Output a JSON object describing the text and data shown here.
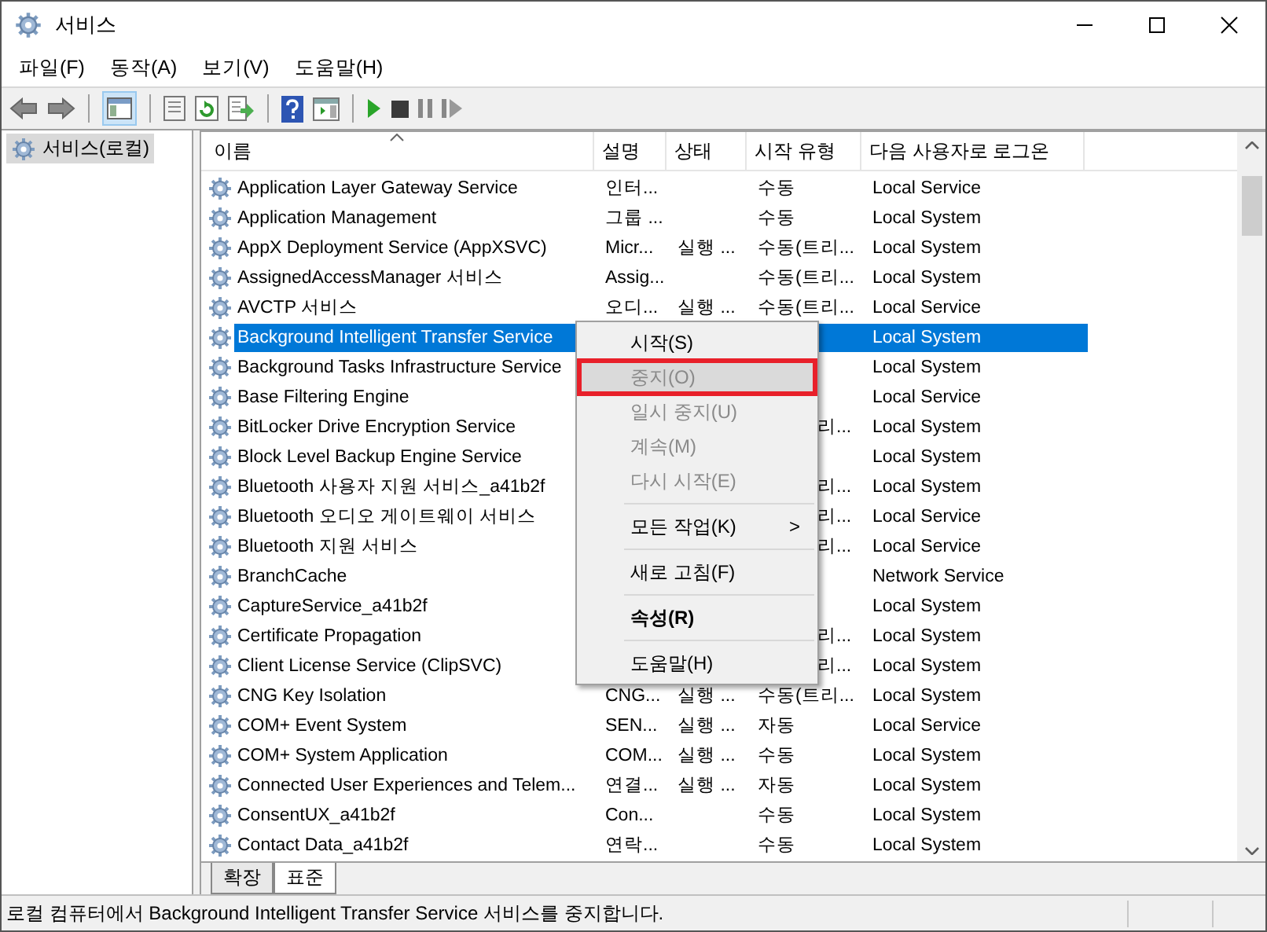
{
  "window": {
    "title": "서비스"
  },
  "menu": [
    "파일(F)",
    "동작(A)",
    "보기(V)",
    "도움말(H)"
  ],
  "toolbar": {
    "console_tree_selected": true
  },
  "tree": [
    {
      "label": "서비스(로컬)",
      "selected": true
    }
  ],
  "table": {
    "columns": [
      {
        "label": "이름",
        "sorted": true
      },
      {
        "label": "설명"
      },
      {
        "label": "상태"
      },
      {
        "label": "시작 유형"
      },
      {
        "label": "다음 사용자로 로그온"
      }
    ],
    "rows": [
      {
        "name": "Application Layer Gateway Service",
        "description": "인터...",
        "start_type": "수동",
        "logon": "Local Service",
        "selected": false
      },
      {
        "name": "Application Management",
        "description": "그룹 ...",
        "start_type": "수동",
        "logon": "Local System",
        "selected": false
      },
      {
        "name": "AppX Deployment Service (AppXSVC)",
        "description": "Micr...",
        "status": "실행 ...",
        "start_type": "수동(트리...",
        "logon": "Local System",
        "selected": false
      },
      {
        "name": "AssignedAccessManager 서비스",
        "description": "Assig...",
        "start_type": "수동(트리...",
        "logon": "Local System",
        "selected": false
      },
      {
        "name": "AVCTP 서비스",
        "description": "오디...",
        "status": "실행 ...",
        "start_type": "수동(트리...",
        "logon": "Local Service",
        "selected": false
      },
      {
        "name": "Background Intelligent Transfer Service",
        "logon": "Local System",
        "selected": true
      },
      {
        "name": "Background Tasks Infrastructure Service",
        "logon": "Local System",
        "selected": false
      },
      {
        "name": "Base Filtering Engine",
        "logon": "Local Service",
        "selected": false
      },
      {
        "name": "BitLocker Drive Encryption Service",
        "start_type": "리...",
        "covered": true,
        "logon": "Local System",
        "selected": false
      },
      {
        "name": "Block Level Backup Engine Service",
        "logon": "Local System",
        "selected": false
      },
      {
        "name": "Bluetooth 사용자 지원 서비스_a41b2f",
        "start_type": "리...",
        "covered": true,
        "logon": "Local System",
        "selected": false
      },
      {
        "name": "Bluetooth 오디오 게이트웨이 서비스",
        "start_type": "리...",
        "covered": true,
        "logon": "Local Service",
        "selected": false
      },
      {
        "name": "Bluetooth 지원 서비스",
        "start_type": "리...",
        "covered": true,
        "logon": "Local Service",
        "selected": false
      },
      {
        "name": "BranchCache",
        "logon": "Network Service",
        "selected": false
      },
      {
        "name": "CaptureService_a41b2f",
        "logon": "Local System",
        "selected": false
      },
      {
        "name": "Certificate Propagation",
        "start_type": "리...",
        "covered": true,
        "logon": "Local System",
        "selected": false
      },
      {
        "name": "Client License Service (ClipSVC)",
        "start_type": "리...",
        "covered": true,
        "logon": "Local System",
        "selected": false
      },
      {
        "name": "CNG Key Isolation",
        "description": "CNG...",
        "status": "실행 ...",
        "start_type": "수동(트리...",
        "logon": "Local System",
        "selected": false
      },
      {
        "name": "COM+ Event System",
        "description": "SEN...",
        "status": "실행 ...",
        "start_type": "자동",
        "logon": "Local Service",
        "selected": false
      },
      {
        "name": "COM+ System Application",
        "description": "COM...",
        "status": "실행 ...",
        "start_type": "수동",
        "logon": "Local System",
        "selected": false
      },
      {
        "name": "Connected User Experiences and Telem...",
        "description": "연결...",
        "status": "실행 ...",
        "start_type": "자동",
        "logon": "Local System",
        "selected": false
      },
      {
        "name": "ConsentUX_a41b2f",
        "description": "Con...",
        "start_type": "수동",
        "logon": "Local System",
        "selected": false
      },
      {
        "name": "Contact Data_a41b2f",
        "description": "연락...",
        "start_type": "수동",
        "logon": "Local System",
        "selected": false
      }
    ]
  },
  "tabs": [
    {
      "label": "확장",
      "selected": false
    },
    {
      "label": "표준",
      "selected": true
    }
  ],
  "context_menu": [
    {
      "kind": "item",
      "label": "시작(S)",
      "disabled": false,
      "highlighted": false
    },
    {
      "kind": "item",
      "label": "중지(O)",
      "disabled": true,
      "highlighted": true
    },
    {
      "kind": "item",
      "label": "일시 중지(U)",
      "disabled": true,
      "highlighted": false
    },
    {
      "kind": "item",
      "label": "계속(M)",
      "disabled": true,
      "highlighted": false
    },
    {
      "kind": "item",
      "label": "다시 시작(E)",
      "disabled": true,
      "highlighted": false
    },
    {
      "kind": "separator"
    },
    {
      "kind": "submenu",
      "label": "모든 작업(K)",
      "arrow": ">",
      "disabled": false,
      "highlighted": false
    },
    {
      "kind": "separator"
    },
    {
      "kind": "item",
      "label": "새로 고침(F)",
      "disabled": false,
      "highlighted": false
    },
    {
      "kind": "separator"
    },
    {
      "kind": "default",
      "label": "속성(R)",
      "disabled": false,
      "highlighted": false
    },
    {
      "kind": "separator"
    },
    {
      "kind": "item",
      "label": "도움말(H)",
      "disabled": false,
      "highlighted": false
    }
  ],
  "status_bar": "로컬 컴퓨터에서 Background Intelligent Transfer Service 서비스를 중지합니다."
}
